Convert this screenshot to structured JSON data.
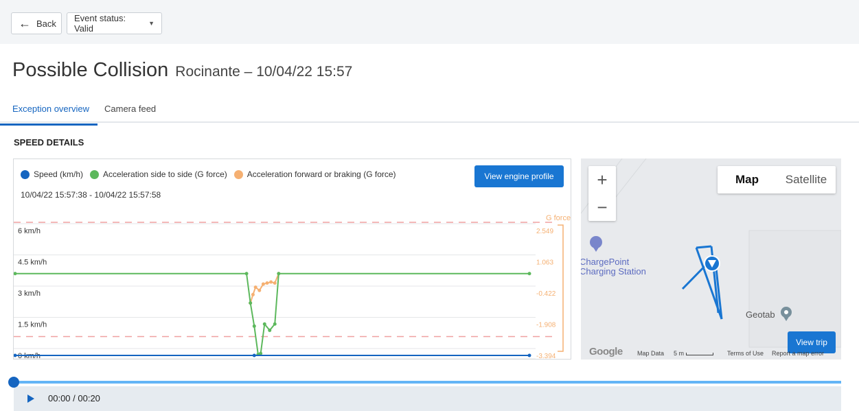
{
  "header": {
    "back_label": "Back",
    "status_label": "Event status: Valid"
  },
  "page": {
    "title": "Possible Collision",
    "subtitle": "Rocinante – 10/04/22 15:57"
  },
  "tabs": [
    {
      "label": "Exception overview"
    },
    {
      "label": "Camera feed"
    }
  ],
  "section": {
    "title": "SPEED DETAILS"
  },
  "chart": {
    "engine_button": "View engine profile",
    "range": "10/04/22 15:57:38 - 10/04/22 15:57:58"
  },
  "chart_data": {
    "type": "line",
    "legend": [
      {
        "name": "Speed (km/h)",
        "color": "#1565c0"
      },
      {
        "name": "Acceleration side to side (G force)",
        "color": "#5cb85c"
      },
      {
        "name": "Acceleration forward or braking (G force)",
        "color": "#f5b072"
      }
    ],
    "y_left_ticks": [
      "6 km/h",
      "4.5 km/h",
      "3 km/h",
      "1.5 km/h",
      "0 km/h"
    ],
    "y_right_label": "G force",
    "y_right_ticks": [
      "2.549",
      "1.063",
      "-0.422",
      "-1.908",
      "-3.394"
    ],
    "x_range_seconds": [
      0,
      20
    ],
    "speed": {
      "x": [
        0,
        9.3,
        20
      ],
      "y": [
        0,
        0,
        0
      ]
    },
    "side": {
      "x": [
        0,
        9.0,
        9.15,
        9.3,
        9.45,
        9.55,
        9.7,
        9.9,
        10.1,
        10.25,
        20
      ],
      "y": [
        0.5,
        0.5,
        -0.9,
        -2.0,
        -3.35,
        -3.3,
        -1.9,
        -2.2,
        -1.9,
        0.5,
        0.5
      ]
    },
    "forward": {
      "x": [
        9.15,
        9.25,
        9.35,
        9.5,
        9.65,
        9.8,
        9.95,
        10.1,
        10.25
      ],
      "y": [
        -0.9,
        -0.5,
        -0.15,
        -0.3,
        0.0,
        0.05,
        0.1,
        0.05,
        0.5
      ]
    },
    "threshold_high": 2.549,
    "threshold_low": -2.4
  },
  "map": {
    "zoom_in": "+",
    "zoom_out": "−",
    "type_map": "Map",
    "type_satellite": "Satellite",
    "poi_1": "ChargePoint",
    "poi_2": "Charging Station",
    "poi_3": "Geotab",
    "view_trip": "View trip",
    "logo": "Google",
    "map_data": "Map Data",
    "scale": "5 m",
    "terms": "Terms of Use",
    "report": "Report a map error"
  },
  "player": {
    "time": "00:00 / 00:20",
    "progress": 0
  }
}
